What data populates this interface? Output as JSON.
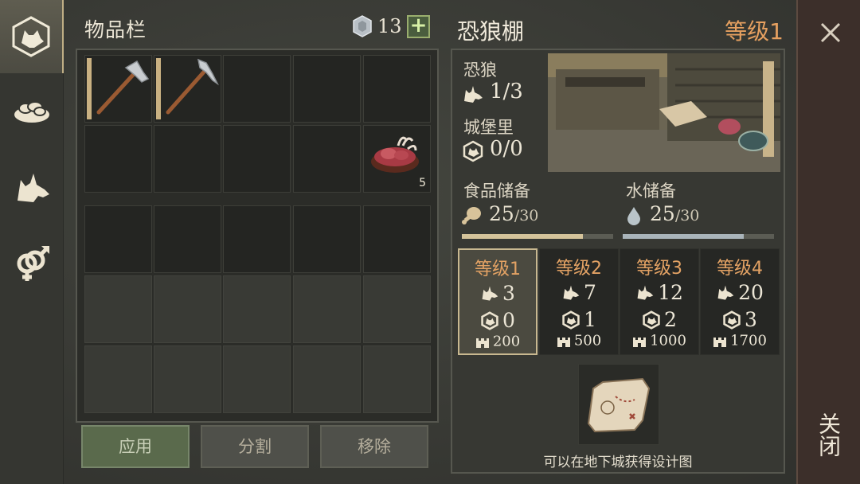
{
  "nav": {
    "items": [
      {
        "name": "wolf-head-icon",
        "active": true
      },
      {
        "name": "food-bowl-icon",
        "active": false
      },
      {
        "name": "wolf-icon",
        "active": false
      },
      {
        "name": "gender-icon",
        "active": false
      }
    ]
  },
  "inventory": {
    "title": "物品栏",
    "coins": "13",
    "plus": "+",
    "slots": [
      {
        "item": "hatchet",
        "durability": 1.0
      },
      {
        "item": "pickaxe",
        "durability": 1.0
      },
      {
        "item": "raw-meat",
        "quantity": "5"
      }
    ],
    "buttons": {
      "apply": "应用",
      "split": "分割",
      "remove": "移除"
    }
  },
  "pen": {
    "title": "恐狼棚",
    "level": "等级1",
    "wolves_label": "恐狼",
    "wolves_value": "1/3",
    "castle_label": "城堡里",
    "castle_value": "0/0",
    "food_label": "食品储备",
    "food_value": "25",
    "food_max": "/30",
    "food_fraction": 0.8,
    "water_label": "水储备",
    "water_value": "25",
    "water_max": "/30",
    "water_fraction": 0.8,
    "levels": [
      {
        "title": "等级1",
        "wolves": "3",
        "castle": "0",
        "cost": "200",
        "active": true
      },
      {
        "title": "等级2",
        "wolves": "7",
        "castle": "1",
        "cost": "500",
        "active": false
      },
      {
        "title": "等级3",
        "wolves": "12",
        "castle": "2",
        "cost": "1000",
        "active": false
      },
      {
        "title": "等级4",
        "wolves": "20",
        "castle": "3",
        "cost": "1700",
        "active": false
      }
    ],
    "blueprint_caption": "可以在地下城获得设计图"
  },
  "close": {
    "label": "关闭"
  },
  "colors": {
    "accent_orange": "#e6a060",
    "food_bar": "#d4c39a",
    "water_bar": "#a9b4ba",
    "apply_green": "#5a6a4c"
  }
}
